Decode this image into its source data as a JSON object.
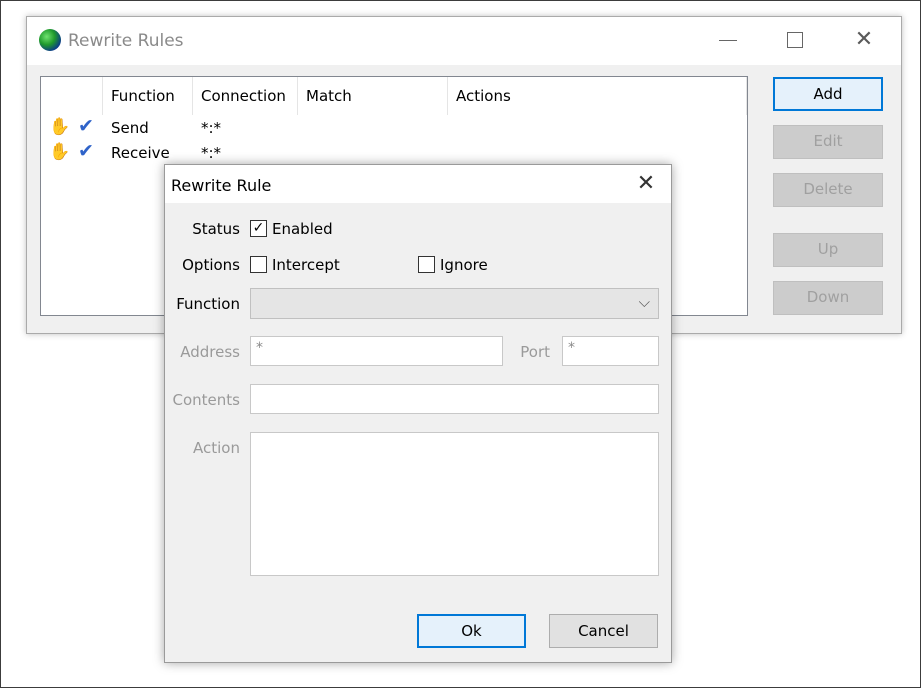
{
  "main_window": {
    "title": "Rewrite Rules",
    "icon": "globe-icon",
    "controls": {
      "minimize": "minimize-icon",
      "maximize": "maximize-icon",
      "close_glyph": "✕"
    },
    "columns": [
      "Function",
      "Connection",
      "Match",
      "Actions"
    ],
    "rules": [
      {
        "function": "Send",
        "connection": "*:*",
        "match": "",
        "actions": "",
        "icons": [
          "hand-icon",
          "check-icon"
        ]
      },
      {
        "function": "Receive",
        "connection": "*:*",
        "match": "",
        "actions": "",
        "icons": [
          "hand-icon",
          "check-icon"
        ]
      }
    ],
    "buttons": {
      "add": "Add",
      "edit": "Edit",
      "delete": "Delete",
      "up": "Up",
      "down": "Down"
    }
  },
  "dialog": {
    "title": "Rewrite Rule",
    "close_glyph": "✕",
    "status_label": "Status",
    "enabled_label": "Enabled",
    "enabled_checked": true,
    "options_label": "Options",
    "intercept_label": "Intercept",
    "intercept_checked": false,
    "ignore_label": "Ignore",
    "ignore_checked": false,
    "function_label": "Function",
    "function_value": "",
    "address_label": "Address",
    "address_value": "*",
    "port_label": "Port",
    "port_value": "*",
    "contents_label": "Contents",
    "contents_value": "",
    "action_label": "Action",
    "action_value": "",
    "ok_label": "Ok",
    "cancel_label": "Cancel"
  },
  "colors": {
    "accent": "#0078d7",
    "check": "#2f63c9",
    "hand": "#c88a12",
    "disabled_text": "#a0a0a0"
  }
}
